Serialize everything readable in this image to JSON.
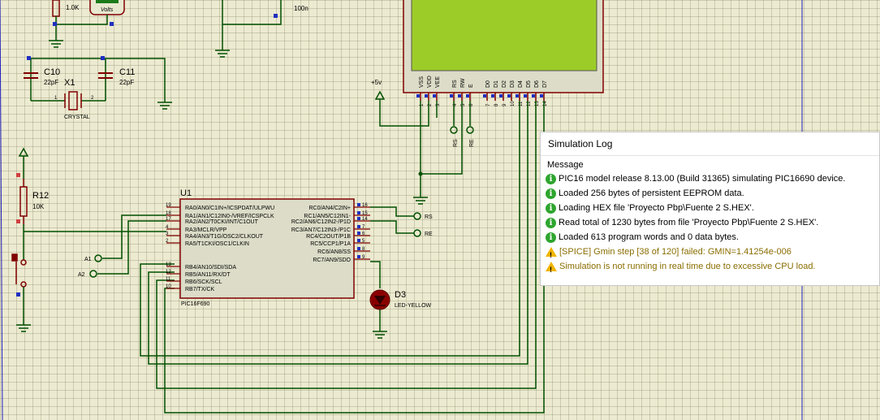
{
  "colors": {
    "wire": "#005000",
    "component": "#800000",
    "pin": "#000080",
    "lcd": "#9ccc28",
    "sheet": "#ecead0"
  },
  "resistor_top": {
    "value": "1.0K"
  },
  "voltmeter": {
    "unit": "Volts"
  },
  "capacitor_top": {
    "value": "100n"
  },
  "c10": {
    "name": "C10",
    "value": "22pF"
  },
  "c11": {
    "name": "C11",
    "value": "22pF"
  },
  "x1": {
    "name": "X1",
    "type": "CRYSTAL",
    "pin1": "1",
    "pin2": "2"
  },
  "r12": {
    "name": "R12",
    "value": "10K"
  },
  "power": {
    "label": "+5v"
  },
  "lcd": {
    "pins": [
      "VSS",
      "VDD",
      "VEE",
      "RS",
      "RW",
      "E",
      "D0",
      "D1",
      "D2",
      "D3",
      "D4",
      "D5",
      "D6",
      "D7"
    ],
    "pin_numbers": [
      "1",
      "2",
      "3",
      "4",
      "5",
      "6",
      "7",
      "8",
      "9",
      "10",
      "11",
      "12",
      "13",
      "14"
    ]
  },
  "terminals": {
    "rs_v": "RS",
    "re_v": "RE",
    "rs": "RS",
    "re": "RE",
    "a1": "A1",
    "a2": "A2"
  },
  "u1": {
    "name": "U1",
    "part": "PIC16F690",
    "left_pins": [
      {
        "num": "19",
        "label": "RA0/AN0/C1IN+/ICSPDAT/ULPWU"
      },
      {
        "num": "18",
        "label": "RA1/AN1/C12IN0-/VREF/ICSPCLK"
      },
      {
        "num": "17",
        "label": "RA2/AN2/T0CKI/INT/C1OUT"
      },
      {
        "num": "4",
        "label": "RA3/MCLR/VPP"
      },
      {
        "num": "3",
        "label": "RA4/AN3/T1G/OSC2/CLKOUT"
      },
      {
        "num": "2",
        "label": "RA5/T1CKI/OSC1/CLKIN"
      },
      {
        "num": "13",
        "label": "RB4/AN10/SDI/SDA"
      },
      {
        "num": "12",
        "label": "RB5/AN11/RX/DT"
      },
      {
        "num": "11",
        "label": "RB6/SCK/SCL"
      },
      {
        "num": "10",
        "label": "RB7/TX/CK"
      }
    ],
    "right_pins": [
      {
        "num": "16",
        "label": "RC0/AN4/C2IN+"
      },
      {
        "num": "15",
        "label": "RC1/AN5/C12IN1-"
      },
      {
        "num": "14",
        "label": "RC2/AN6/C12IN2-/P1D"
      },
      {
        "num": "7",
        "label": "RC3/AN7/C12IN3-/P1C"
      },
      {
        "num": "6",
        "label": "RC4/C2OUT/P1B"
      },
      {
        "num": "5",
        "label": "RC5/CCP1/P1A"
      },
      {
        "num": "8",
        "label": "RC6/AN8/SS"
      },
      {
        "num": "9",
        "label": "RC7/AN9/SDO"
      }
    ]
  },
  "d3": {
    "name": "D3",
    "type": "LED-YELLOW"
  },
  "simlog": {
    "title": "Simulation Log",
    "column": "Message",
    "messages": [
      {
        "level": "info",
        "text": "PIC16 model release 8.13.00 (Build 31365) simulating PIC16690 device."
      },
      {
        "level": "info",
        "text": "Loaded 256 bytes of persistent EEPROM data."
      },
      {
        "level": "info",
        "text": "Loading HEX file 'Proyecto Pbp\\Fuente 2 S.HEX'."
      },
      {
        "level": "info",
        "text": "Read total of 1230 bytes from file 'Proyecto Pbp\\Fuente 2 S.HEX'."
      },
      {
        "level": "info",
        "text": "Loaded 613 program words and 0 data bytes."
      },
      {
        "level": "warning",
        "text": "[SPICE] Gmin step [38 of 120] failed: GMIN=1.41254e-006"
      },
      {
        "level": "warning",
        "text": "Simulation is not running in real time due to excessive CPU load."
      }
    ]
  }
}
